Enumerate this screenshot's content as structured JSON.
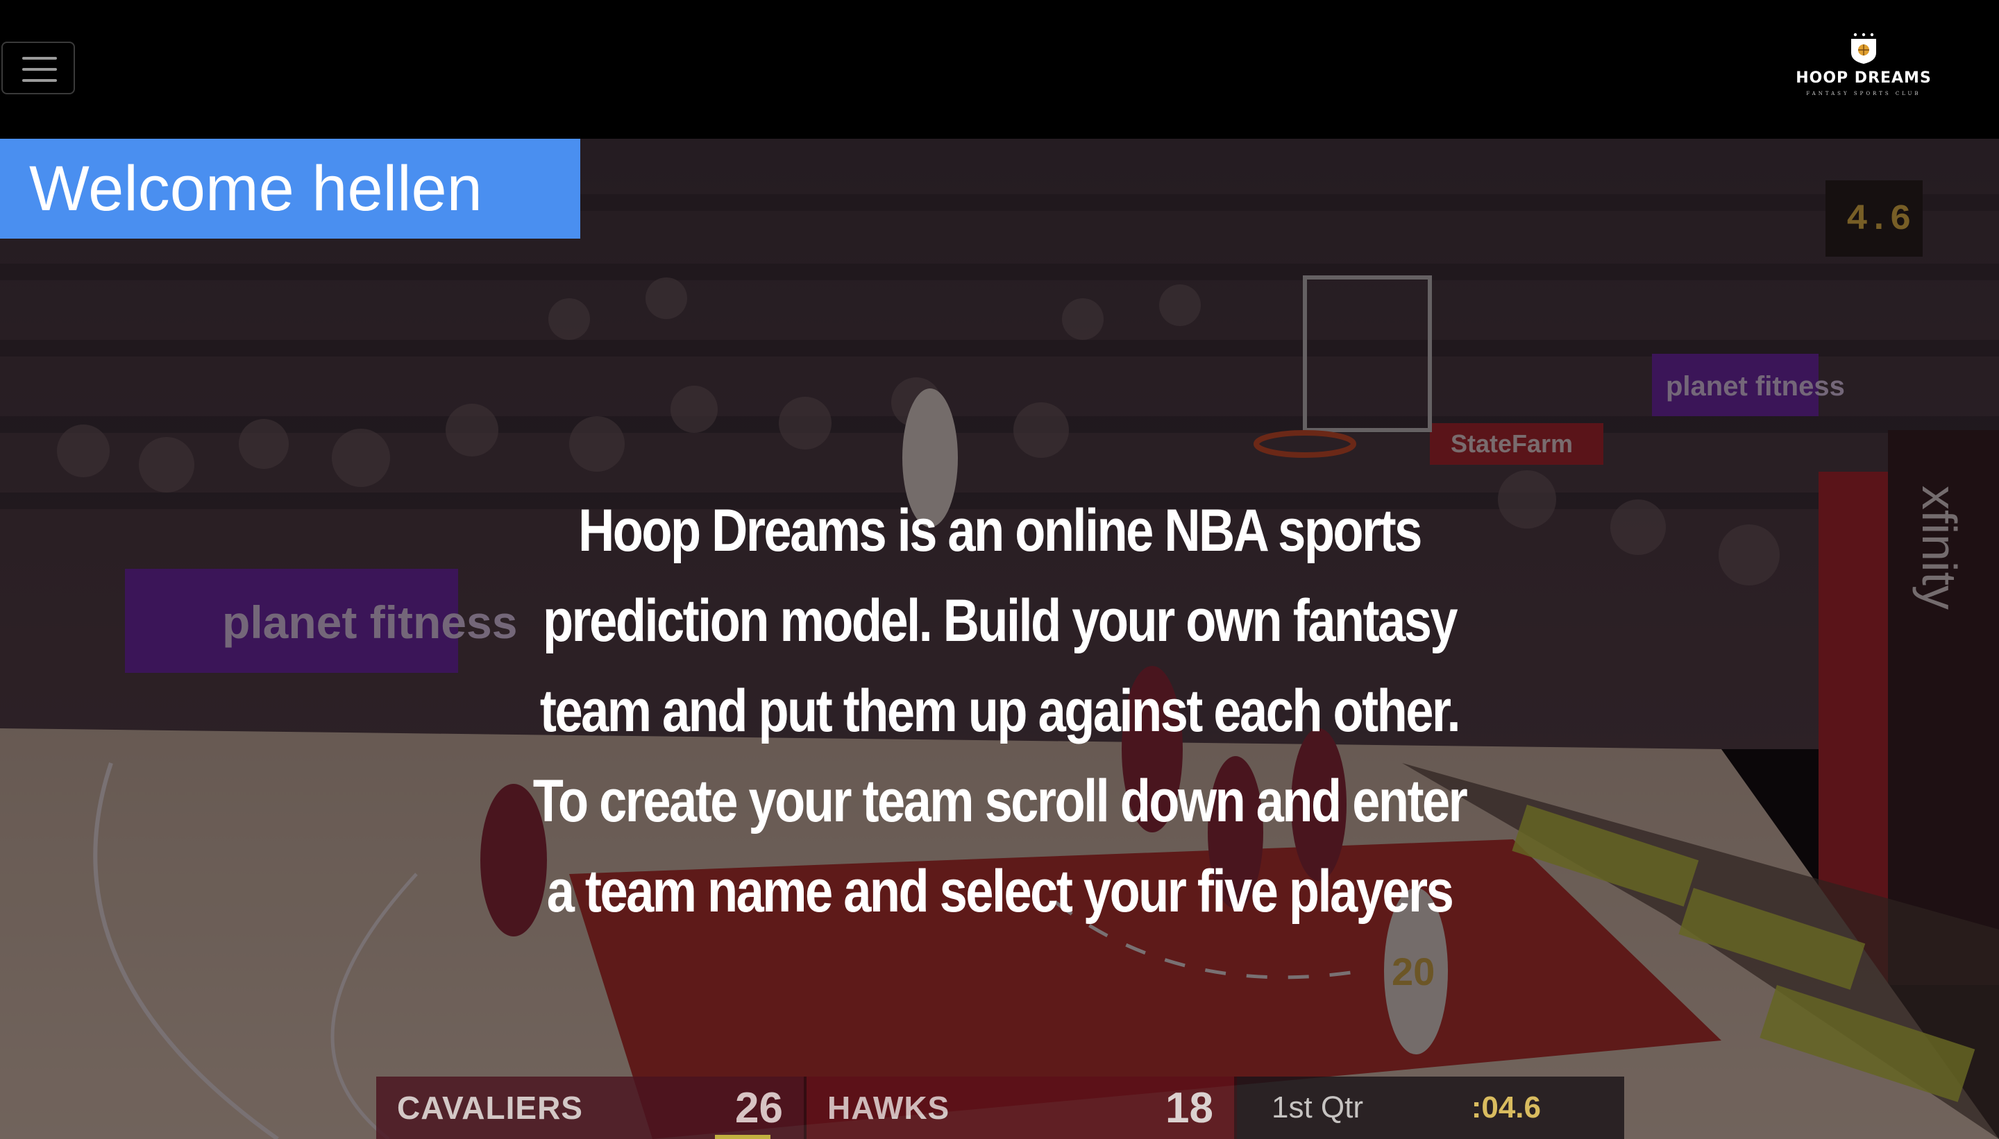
{
  "navbar": {
    "menu_icon": "hamburger-menu-icon",
    "brand": {
      "name": "HOOP DREAMS",
      "tagline": "FANTASY SPORTS CLUB",
      "crest_icon": "basketball-crest-icon"
    }
  },
  "welcome": {
    "text": "Welcome hellen",
    "background": "#4a8ff0"
  },
  "intro": {
    "text": "Hoop Dreams is an online NBA sports prediction model. Build your own fantasy team and put them up against each other. To create your team scroll down and enter a team name and select your five players"
  },
  "hero_scene": {
    "arena_signage": [
      "planet fitness",
      "planet fitness",
      "StateFarm",
      "xfinity"
    ],
    "shot_clock": "4.6",
    "player_number": "20",
    "scoreboard": {
      "away_team": "CAVALIERS",
      "away_score": "26",
      "home_team": "HAWKS",
      "home_score": "18",
      "period": "1st Qtr",
      "time": ":04.6"
    }
  }
}
